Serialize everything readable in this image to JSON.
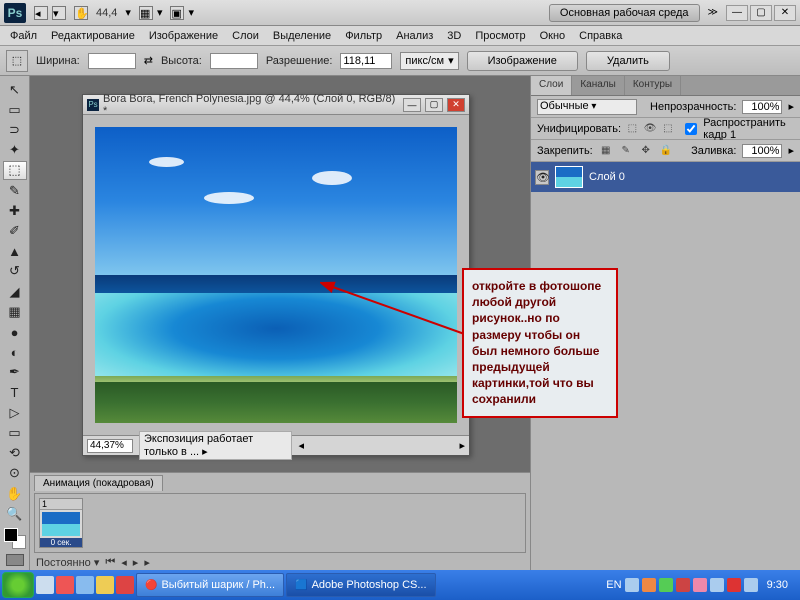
{
  "topbar": {
    "logo": "Ps",
    "zoom": "44,4",
    "workspace_btn": "Основная рабочая среда"
  },
  "menu": [
    "Файл",
    "Редактирование",
    "Изображение",
    "Слои",
    "Выделение",
    "Фильтр",
    "Анализ",
    "3D",
    "Просмотр",
    "Окно",
    "Справка"
  ],
  "options": {
    "width_label": "Ширина:",
    "width_val": "",
    "height_label": "Высота:",
    "height_val": "",
    "res_label": "Разрешение:",
    "res_val": "118,11",
    "units": "пикс/см",
    "btn_image": "Изображение",
    "btn_delete": "Удалить"
  },
  "document": {
    "title": "Bora Bora, French Polynesia.jpg @ 44,4% (Слой 0, RGB/8) *",
    "zoom": "44,37%",
    "status": "Экспозиция работает только в ..."
  },
  "animation": {
    "tab": "Анимация (покадровая)",
    "frame_num": "1",
    "frame_time": "0 сек.",
    "mode": "Постоянно"
  },
  "panels": {
    "tabs": [
      "Слои",
      "Каналы",
      "Контуры"
    ],
    "blend": "Обычные",
    "opacity_label": "Непрозрачность:",
    "opacity_val": "100%",
    "unify_label": "Унифицировать:",
    "propagate_label": "Распространить кадр 1",
    "lock_label": "Закрепить:",
    "fill_label": "Заливка:",
    "fill_val": "100%",
    "layer_name": "Слой 0"
  },
  "callout": "откройте в фотошопе любой другой рисунок..но по размеру чтобы он был немного больше предыдущей картинки,той что вы сохранили",
  "taskbar": {
    "task1": "Выбитый шарик / Ph...",
    "task2": "Adobe Photoshop CS...",
    "lang": "EN",
    "clock": "9:30"
  }
}
